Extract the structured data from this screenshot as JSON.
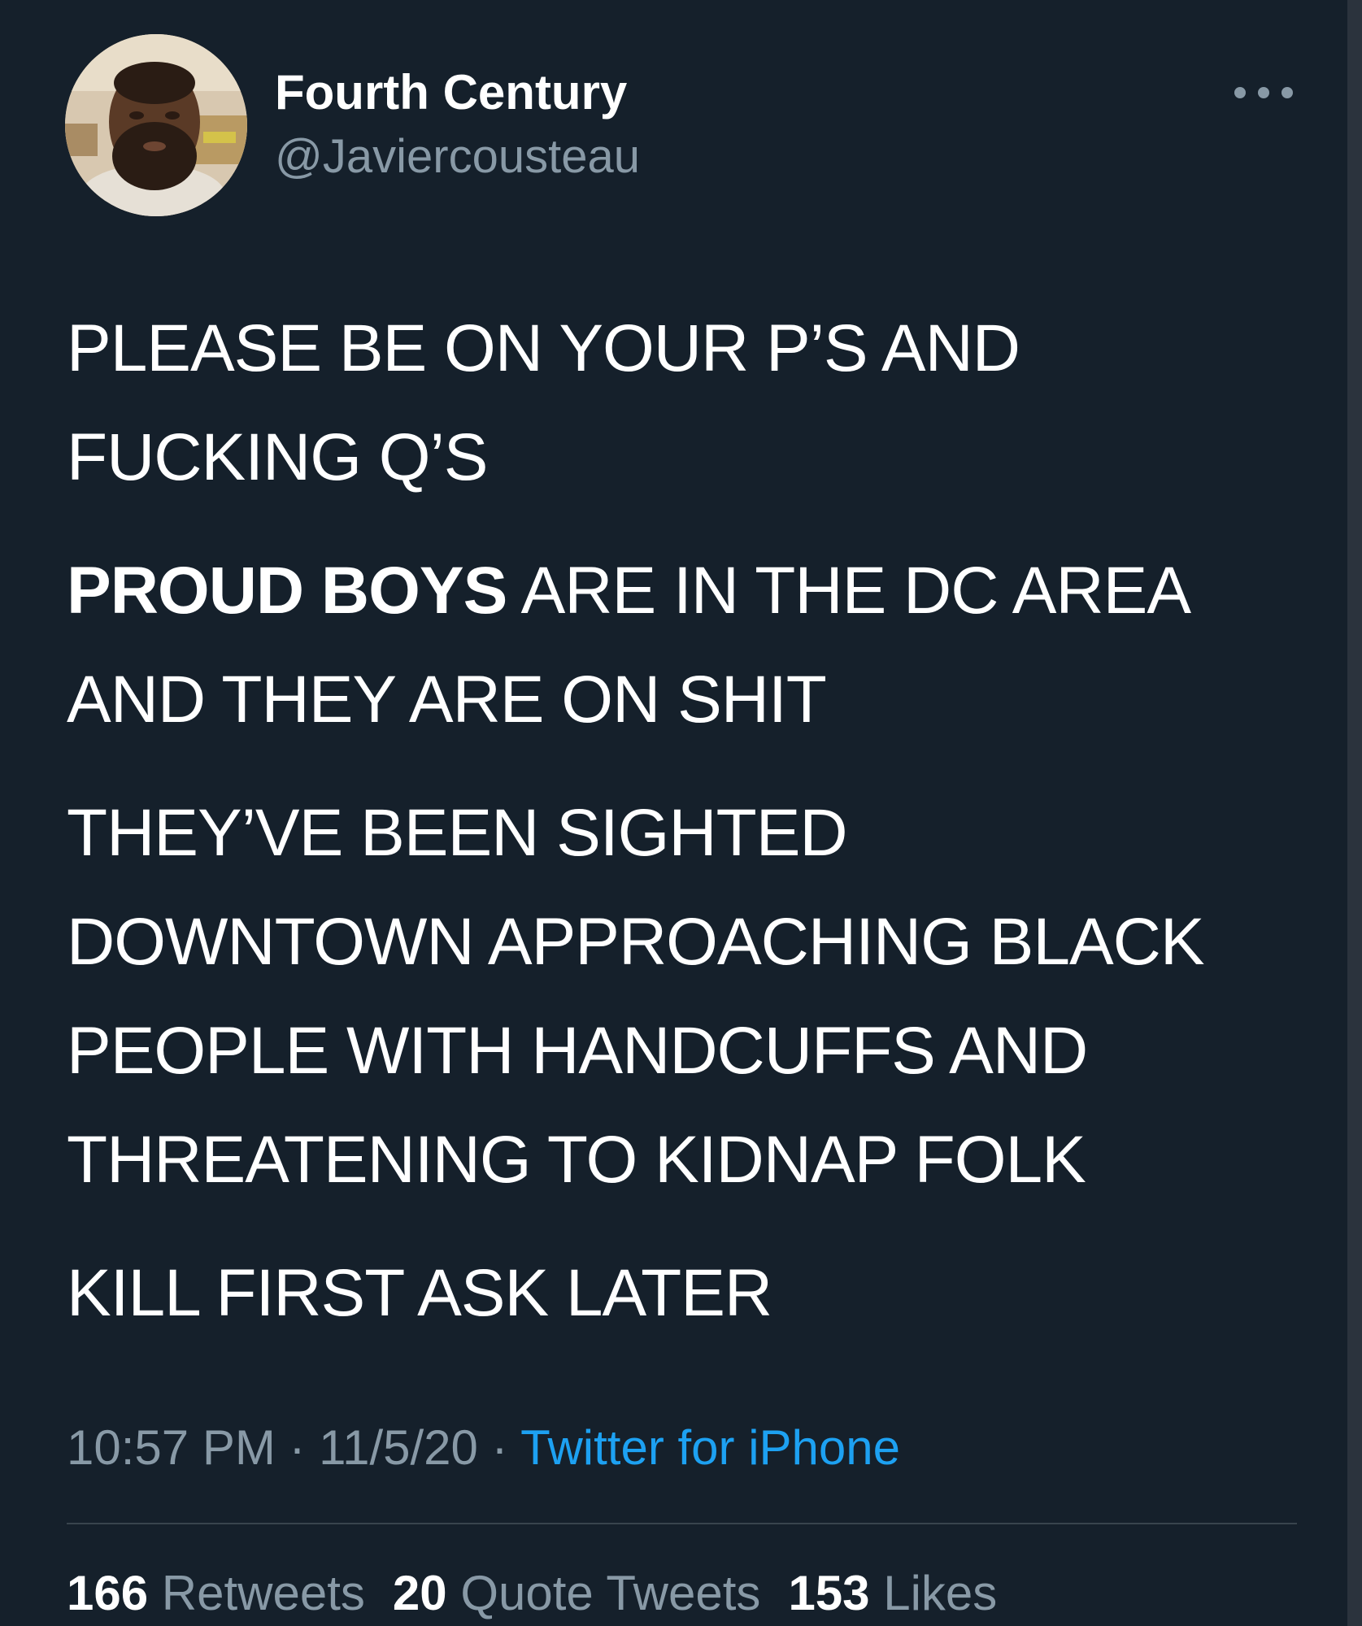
{
  "colors": {
    "background": "#15202b",
    "text_primary": "#ffffff",
    "text_secondary": "#8899a6",
    "link_accent": "#1da1f2",
    "divider": "#38444d"
  },
  "header": {
    "display_name": "Fourth Century",
    "handle": "@Javiercousteau",
    "more_icon": "more-dots-icon"
  },
  "body": {
    "p1": {
      "line1": "PLEASE BE ON YOUR P’S AND",
      "line2": "FUCKING Q’S"
    },
    "p2": {
      "bold": "PROUD BOYS",
      "rest": " ARE IN THE DC AREA",
      "line2": "AND THEY ARE ON SHIT"
    },
    "p3": {
      "line1": "THEY’VE BEEN SIGHTED",
      "line2": "DOWNTOWN APPROACHING BLACK",
      "line3": "PEOPLE WITH HANDCUFFS AND",
      "line4": "THREATENING TO KIDNAP FOLK"
    },
    "p4": {
      "line1": "KILL FIRST ASK LATER"
    }
  },
  "meta": {
    "time": "10:57 PM",
    "separator": " · ",
    "date": "11/5/20",
    "source": "Twitter for iPhone"
  },
  "stats": {
    "retweets_count": "166",
    "retweets_label": "Retweets",
    "quotes_count": "20",
    "quotes_label": "Quote Tweets",
    "likes_count": "153",
    "likes_label": "Likes"
  }
}
